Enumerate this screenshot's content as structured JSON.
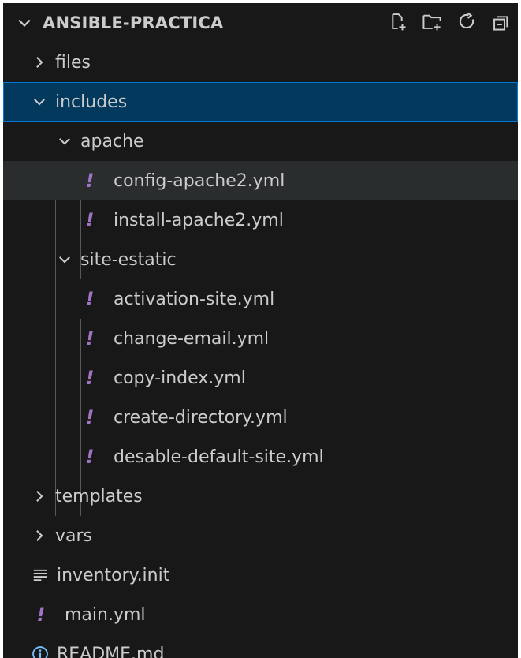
{
  "explorer": {
    "section_title": "ANSIBLE-PRACTICA",
    "header_actions": [
      {
        "name": "new-file-icon"
      },
      {
        "name": "new-folder-icon"
      },
      {
        "name": "refresh-icon"
      },
      {
        "name": "collapse-all-icon"
      }
    ],
    "tree": {
      "files": "files",
      "includes": "includes",
      "apache": "apache",
      "config_apache2": "config-apache2.yml",
      "install_apache2": "install-apache2.yml",
      "site_estatic": "site-estatic",
      "activation_site": "activation-site.yml",
      "change_email": "change-email.yml",
      "copy_index": "copy-index.yml",
      "create_directory": "create-directory.yml",
      "desable_default_site": "desable-default-site.yml",
      "templates": "templates",
      "vars": "vars",
      "inventory": "inventory.init",
      "main": "main.yml",
      "readme": "README.md"
    },
    "yaml_glyph": "!",
    "colors": {
      "background": "#181818",
      "text": "#cccccc",
      "selected_bg": "#04395e",
      "selected_border": "#0078d4",
      "hover_bg": "#2a2d2e",
      "yaml_icon": "#a074c4",
      "info_icon": "#75beff"
    }
  }
}
